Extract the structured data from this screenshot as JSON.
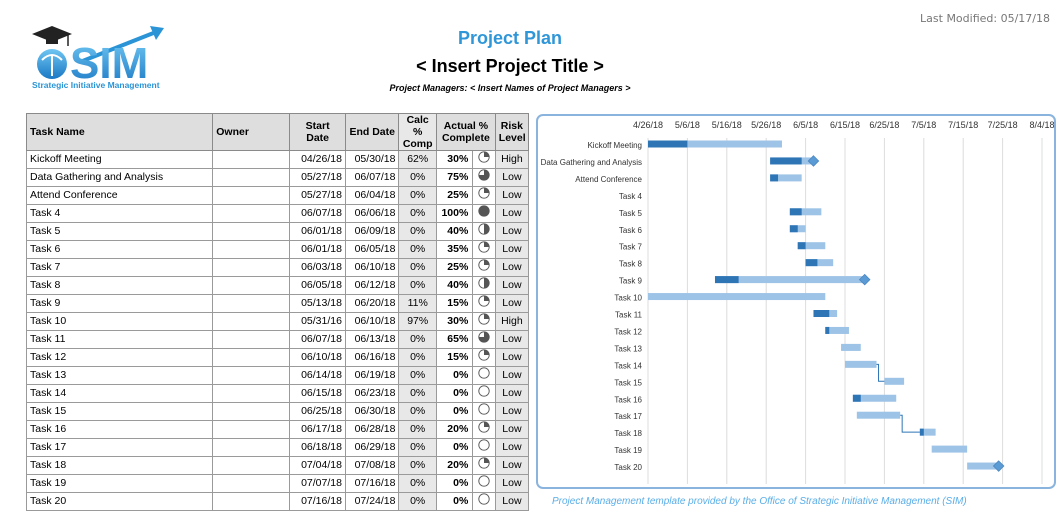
{
  "header": {
    "last_modified": "Last Modified: 05/17/18",
    "title": "Project Plan",
    "subtitle": "< Insert Project Title >",
    "project_managers": "Project Managers: < Insert Names of Project Managers >",
    "logo_text": "SIM",
    "logo_tagline": "Strategic Initiative Management"
  },
  "table": {
    "columns": {
      "task_name": "Task Name",
      "owner": "Owner",
      "start_date": "Start Date",
      "end_date": "End Date",
      "calc_comp": "Calc % Comp",
      "actual_complete": "Actual % Complete",
      "risk_level": "Risk Level"
    },
    "rows": [
      {
        "name": "Kickoff Meeting",
        "owner": "",
        "start": "04/26/18",
        "end": "05/30/18",
        "calc": "62%",
        "actual": "30%",
        "risk": "High"
      },
      {
        "name": "Data Gathering and Analysis",
        "owner": "",
        "start": "05/27/18",
        "end": "06/07/18",
        "calc": "0%",
        "actual": "75%",
        "risk": "Low"
      },
      {
        "name": "Attend Conference",
        "owner": "",
        "start": "05/27/18",
        "end": "06/04/18",
        "calc": "0%",
        "actual": "25%",
        "risk": "Low"
      },
      {
        "name": "Task 4",
        "owner": "",
        "start": "06/07/18",
        "end": "06/06/18",
        "calc": "0%",
        "actual": "100%",
        "risk": "Low"
      },
      {
        "name": "Task 5",
        "owner": "",
        "start": "06/01/18",
        "end": "06/09/18",
        "calc": "0%",
        "actual": "40%",
        "risk": "Low"
      },
      {
        "name": "Task 6",
        "owner": "",
        "start": "06/01/18",
        "end": "06/05/18",
        "calc": "0%",
        "actual": "35%",
        "risk": "Low"
      },
      {
        "name": "Task 7",
        "owner": "",
        "start": "06/03/18",
        "end": "06/10/18",
        "calc": "0%",
        "actual": "25%",
        "risk": "Low"
      },
      {
        "name": "Task 8",
        "owner": "",
        "start": "06/05/18",
        "end": "06/12/18",
        "calc": "0%",
        "actual": "40%",
        "risk": "Low"
      },
      {
        "name": "Task 9",
        "owner": "",
        "start": "05/13/18",
        "end": "06/20/18",
        "calc": "11%",
        "actual": "15%",
        "risk": "Low"
      },
      {
        "name": "Task 10",
        "owner": "",
        "start": "05/31/16",
        "end": "06/10/18",
        "calc": "97%",
        "actual": "30%",
        "risk": "High"
      },
      {
        "name": "Task 11",
        "owner": "",
        "start": "06/07/18",
        "end": "06/13/18",
        "calc": "0%",
        "actual": "65%",
        "risk": "Low"
      },
      {
        "name": "Task 12",
        "owner": "",
        "start": "06/10/18",
        "end": "06/16/18",
        "calc": "0%",
        "actual": "15%",
        "risk": "Low"
      },
      {
        "name": "Task 13",
        "owner": "",
        "start": "06/14/18",
        "end": "06/19/18",
        "calc": "0%",
        "actual": "0%",
        "risk": "Low"
      },
      {
        "name": "Task 14",
        "owner": "",
        "start": "06/15/18",
        "end": "06/23/18",
        "calc": "0%",
        "actual": "0%",
        "risk": "Low"
      },
      {
        "name": "Task 15",
        "owner": "",
        "start": "06/25/18",
        "end": "06/30/18",
        "calc": "0%",
        "actual": "0%",
        "risk": "Low"
      },
      {
        "name": "Task 16",
        "owner": "",
        "start": "06/17/18",
        "end": "06/28/18",
        "calc": "0%",
        "actual": "20%",
        "risk": "Low"
      },
      {
        "name": "Task 17",
        "owner": "",
        "start": "06/18/18",
        "end": "06/29/18",
        "calc": "0%",
        "actual": "0%",
        "risk": "Low"
      },
      {
        "name": "Task 18",
        "owner": "",
        "start": "07/04/18",
        "end": "07/08/18",
        "calc": "0%",
        "actual": "20%",
        "risk": "Low"
      },
      {
        "name": "Task 19",
        "owner": "",
        "start": "07/07/18",
        "end": "07/16/18",
        "calc": "0%",
        "actual": "0%",
        "risk": "Low"
      },
      {
        "name": "Task 20",
        "owner": "",
        "start": "07/16/18",
        "end": "07/24/18",
        "calc": "0%",
        "actual": "0%",
        "risk": "Low"
      }
    ]
  },
  "chart_data": {
    "type": "gantt",
    "x_ticks": [
      "4/26/18",
      "5/6/18",
      "5/16/18",
      "5/26/18",
      "6/5/18",
      "6/15/18",
      "6/25/18",
      "7/5/18",
      "7/15/18",
      "7/25/18",
      "8/4/18"
    ],
    "categories": [
      "Kickoff Meeting",
      "Data Gathering and Analysis",
      "Attend Conference",
      "Task 4",
      "Task 5",
      "Task 6",
      "Task 7",
      "Task 8",
      "Task 9",
      "Task 10",
      "Task 11",
      "Task 12",
      "Task 13",
      "Task 14",
      "Task 15",
      "Task 16",
      "Task 17",
      "Task 18",
      "Task 19",
      "Task 20"
    ],
    "bars": [
      {
        "start": "2018-04-26",
        "done": "2018-05-06",
        "end": "2018-05-30"
      },
      {
        "start": "2018-05-27",
        "done": "2018-06-04",
        "end": "2018-06-07",
        "milestone": true
      },
      {
        "start": "2018-05-27",
        "done": "2018-05-29",
        "end": "2018-06-04"
      },
      null,
      {
        "start": "2018-06-01",
        "done": "2018-06-04",
        "end": "2018-06-09"
      },
      {
        "start": "2018-06-01",
        "done": "2018-06-03",
        "end": "2018-06-05"
      },
      {
        "start": "2018-06-03",
        "done": "2018-06-05",
        "end": "2018-06-10"
      },
      {
        "start": "2018-06-05",
        "done": "2018-06-08",
        "end": "2018-06-12"
      },
      {
        "start": "2018-05-13",
        "done": "2018-05-19",
        "end": "2018-06-20",
        "milestone": true
      },
      {
        "start": "2018-04-26",
        "done": "2018-04-26",
        "end": "2018-06-10"
      },
      {
        "start": "2018-06-07",
        "done": "2018-06-11",
        "end": "2018-06-13"
      },
      {
        "start": "2018-06-10",
        "done": "2018-06-11",
        "end": "2018-06-16"
      },
      {
        "start": "2018-06-14",
        "done": "2018-06-14",
        "end": "2018-06-19"
      },
      {
        "start": "2018-06-15",
        "done": "2018-06-15",
        "end": "2018-06-23"
      },
      {
        "start": "2018-06-25",
        "done": "2018-06-25",
        "end": "2018-06-30"
      },
      {
        "start": "2018-06-17",
        "done": "2018-06-19",
        "end": "2018-06-28"
      },
      {
        "start": "2018-06-18",
        "done": "2018-06-18",
        "end": "2018-06-29"
      },
      {
        "start": "2018-07-04",
        "done": "2018-07-05",
        "end": "2018-07-08"
      },
      {
        "start": "2018-07-07",
        "done": "2018-07-07",
        "end": "2018-07-16"
      },
      {
        "start": "2018-07-16",
        "done": "2018-07-16",
        "end": "2018-07-24",
        "milestone": true
      }
    ],
    "dependencies": [
      [
        13,
        14
      ],
      [
        16,
        17
      ]
    ],
    "colors": {
      "done": "#2e75b6",
      "remaining": "#9dc3e6",
      "milestone": "#5b9bd5",
      "border": "#8ab4de"
    }
  },
  "footer": "Project Management template provided by the Office of Strategic Initiative Management (SIM)"
}
